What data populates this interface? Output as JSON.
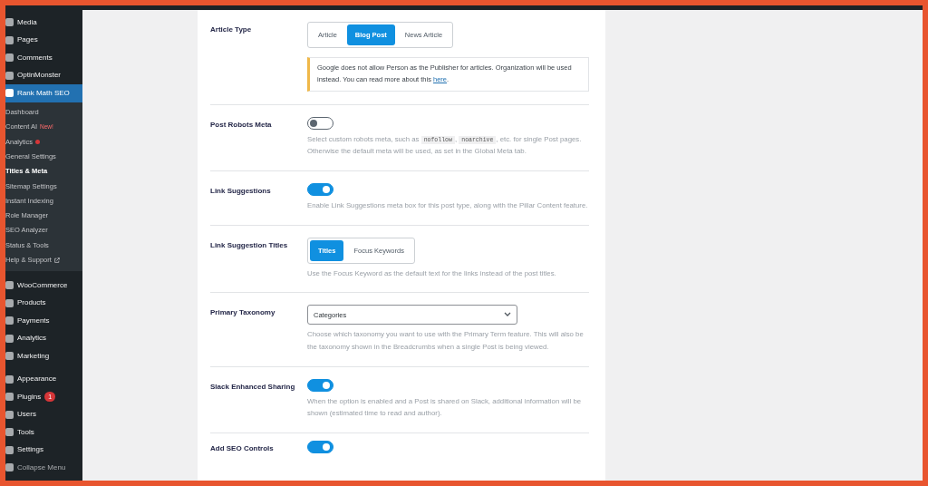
{
  "sidebar": {
    "items": [
      {
        "label": "Media",
        "selected": false
      },
      {
        "label": "Pages",
        "selected": false
      },
      {
        "label": "Comments",
        "selected": false
      },
      {
        "label": "OptinMonster",
        "selected": false
      },
      {
        "label": "Rank Math SEO",
        "selected": true,
        "submenu": [
          {
            "label": "Dashboard",
            "selected": false
          },
          {
            "label": "Content AI",
            "selected": false,
            "tag": "New!"
          },
          {
            "label": "Analytics",
            "selected": false,
            "dot": true
          },
          {
            "label": "General Settings",
            "selected": false
          },
          {
            "label": "Titles & Meta",
            "selected": true
          },
          {
            "label": "Sitemap Settings",
            "selected": false
          },
          {
            "label": "Instant Indexing",
            "selected": false
          },
          {
            "label": "Role Manager",
            "selected": false
          },
          {
            "label": "SEO Analyzer",
            "selected": false
          },
          {
            "label": "Status & Tools",
            "selected": false
          },
          {
            "label": "Help & Support",
            "selected": false,
            "external": true
          }
        ]
      },
      {
        "label": "WooCommerce",
        "selected": false,
        "group_start": true
      },
      {
        "label": "Products",
        "selected": false
      },
      {
        "label": "Payments",
        "selected": false
      },
      {
        "label": "Analytics",
        "selected": false
      },
      {
        "label": "Marketing",
        "selected": false
      },
      {
        "label": "Appearance",
        "selected": false,
        "group_start": true
      },
      {
        "label": "Plugins",
        "selected": false,
        "badge": "1"
      },
      {
        "label": "Users",
        "selected": false
      },
      {
        "label": "Tools",
        "selected": false
      },
      {
        "label": "Settings",
        "selected": false
      },
      {
        "label": "Collapse Menu",
        "selected": false,
        "kind": "collapse"
      }
    ]
  },
  "settings": [
    {
      "kind": "segmented",
      "label": "Article Type",
      "options": [
        {
          "label": "Article",
          "selected": false
        },
        {
          "label": "Blog Post",
          "selected": true
        },
        {
          "label": "News Article",
          "selected": false
        }
      ],
      "notice": {
        "text": "Google does not allow Person as the Publisher for articles. Organization will be used instead. You can read more about this ",
        "link": "here",
        "after": "."
      }
    },
    {
      "kind": "toggle",
      "label": "Post Robots Meta",
      "on": false,
      "description": [
        {
          "text": "Select custom robots meta, such as "
        },
        {
          "code": "nofollow"
        },
        {
          "text": ", "
        },
        {
          "code": "noarchive"
        },
        {
          "text": ", etc. for single Post pages. Otherwise the default meta will be used, as set in the Global Meta tab."
        }
      ]
    },
    {
      "kind": "toggle",
      "label": "Link Suggestions",
      "on": true,
      "description": [
        {
          "text": "Enable Link Suggestions meta box for this post type, along with the Pillar Content feature."
        }
      ]
    },
    {
      "kind": "segmented",
      "label": "Link Suggestion Titles",
      "options": [
        {
          "label": "Titles",
          "selected": true
        },
        {
          "label": "Focus Keywords",
          "selected": false
        }
      ],
      "description": [
        {
          "text": "Use the Focus Keyword as the default text for the links instead of the post titles."
        }
      ]
    },
    {
      "kind": "select",
      "label": "Primary Taxonomy",
      "value": "Categories",
      "description": [
        {
          "text": "Choose which taxonomy you want to use with the Primary Term feature. This will also be the taxonomy shown in the Breadcrumbs when a single Post is being viewed."
        }
      ]
    },
    {
      "kind": "toggle",
      "label": "Slack Enhanced Sharing",
      "on": true,
      "description": [
        {
          "text": "When the option is enabled and a Post is shared on Slack, additional information will be shown (estimated time to read and author)."
        }
      ]
    },
    {
      "kind": "toggle",
      "label": "Add SEO Controls",
      "on": true
    }
  ]
}
